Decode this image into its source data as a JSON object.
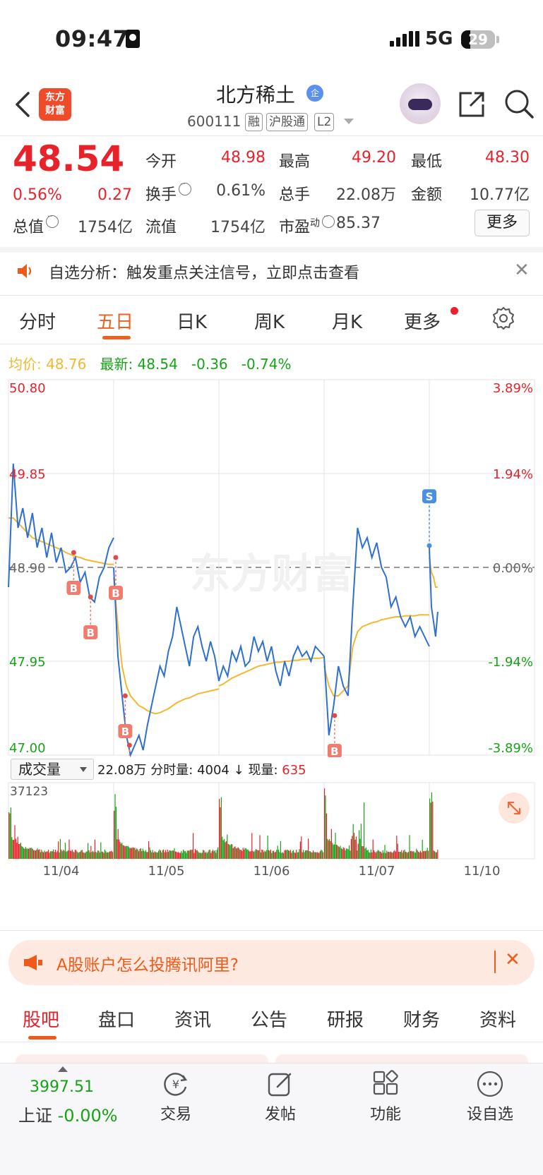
{
  "status_bar": {
    "time": "09:47",
    "network": "5G",
    "battery": "29"
  },
  "header": {
    "logo_line1": "东方",
    "logo_line2": "财富",
    "stock_name": "北方稀土",
    "company_badge": "企",
    "stock_code": "600111",
    "tags": [
      "融",
      "沪股通",
      "L2"
    ]
  },
  "quote": {
    "price": "48.54",
    "change_pct": "0.56%",
    "change": "0.27",
    "open_label": "今开",
    "open": "48.98",
    "high_label": "最高",
    "high": "49.20",
    "low_label": "最低",
    "low": "48.30",
    "turnover_label": "换手",
    "turnover": "0.61%",
    "volume_label": "总手",
    "volume": "22.08万",
    "amount_label": "金额",
    "amount": "10.77亿",
    "mktcap_label": "总值",
    "mktcap": "1754亿",
    "float_label": "流值",
    "float_cap": "1754亿",
    "pe_label": "市盈",
    "pe_sup": "动",
    "pe": "85.37",
    "more": "更多"
  },
  "notice": {
    "text": "自选分析：触发重点关注信号，立即点击查看"
  },
  "chart_tabs": [
    "分时",
    "五日",
    "日K",
    "周K",
    "月K",
    "更多"
  ],
  "avg_line": {
    "avg_label": "均价:",
    "avg_value": "48.76",
    "latest_label": "最新:",
    "latest_value": "48.54",
    "change": "-0.36",
    "change_pct": "-0.74%"
  },
  "chart_data": {
    "type": "line",
    "title": "",
    "y_left_ticks": [
      "50.80",
      "49.85",
      "48.90",
      "47.95",
      "47.00"
    ],
    "y_right_ticks": [
      "3.89%",
      "1.94%",
      "0.00%",
      "-1.94%",
      "-3.89%"
    ],
    "ylim": [
      47.0,
      50.8
    ],
    "reference": 48.9,
    "x_labels": [
      "11/04",
      "11/05",
      "11/06",
      "11/07",
      "11/10"
    ],
    "colors": {
      "price": "#2e6fd0",
      "avg": "#f2b830",
      "up": "#e8222a",
      "down": "#17a317",
      "marker_b": "#f07c6e",
      "marker_s": "#4a90e2"
    },
    "series": [
      {
        "day": "11/04",
        "price": [
          48.7,
          49.95,
          49.3,
          49.5,
          49.2,
          49.45,
          49.1,
          49.3,
          49.0,
          49.25,
          48.95,
          49.1,
          48.85,
          48.9,
          49.0,
          48.75,
          48.85,
          48.6,
          48.55,
          48.8,
          48.9,
          49.1,
          49.2
        ],
        "avg": [
          49.4,
          49.4,
          49.35,
          49.3,
          49.25,
          49.2,
          49.18,
          49.16,
          49.14,
          49.12,
          49.1,
          49.08,
          49.05,
          49.03,
          49.01,
          49.0,
          48.98,
          48.97,
          48.96,
          48.95,
          48.94,
          48.93,
          48.93
        ]
      },
      {
        "day": "11/05",
        "price": [
          48.9,
          48.0,
          47.6,
          47.2,
          47.0,
          47.1,
          47.2,
          47.05,
          47.3,
          47.5,
          47.7,
          47.9,
          47.8,
          48.05,
          48.2,
          48.5,
          48.3,
          48.1,
          47.9,
          48.2,
          48.3,
          48.1,
          47.95,
          48.15,
          48.0,
          47.75
        ],
        "avg": [
          48.8,
          48.3,
          47.9,
          47.7,
          47.6,
          47.55,
          47.5,
          47.48,
          47.45,
          47.43,
          47.42,
          47.43,
          47.45,
          47.47,
          47.5,
          47.53,
          47.55,
          47.57,
          47.58,
          47.6,
          47.62,
          47.63,
          47.64,
          47.65,
          47.66,
          47.67
        ]
      },
      {
        "day": "11/06",
        "price": [
          47.75,
          47.9,
          47.8,
          48.05,
          47.95,
          48.1,
          47.9,
          47.95,
          48.2,
          48.05,
          48.15,
          47.95,
          48.1,
          47.85,
          47.7,
          47.95,
          47.8,
          48.0,
          48.1,
          48.0,
          48.05,
          47.95,
          48.1,
          48.05,
          48.0
        ],
        "avg": [
          47.7,
          47.72,
          47.75,
          47.78,
          47.8,
          47.82,
          47.84,
          47.86,
          47.88,
          47.9,
          47.91,
          47.92,
          47.93,
          47.94,
          47.94,
          47.95,
          47.95,
          47.96,
          47.96,
          47.97,
          47.97,
          47.98,
          47.98,
          47.98,
          47.99
        ]
      },
      {
        "day": "11/07",
        "price": [
          48.0,
          47.2,
          47.5,
          47.9,
          47.7,
          47.6,
          48.5,
          49.3,
          49.1,
          49.2,
          49.0,
          49.15,
          48.9,
          48.8,
          48.5,
          48.6,
          48.4,
          48.3,
          48.4,
          48.2,
          48.3,
          48.2,
          48.1
        ],
        "avg": [
          47.9,
          47.7,
          47.6,
          47.6,
          47.65,
          47.7,
          48.1,
          48.25,
          48.3,
          48.32,
          48.34,
          48.35,
          48.37,
          48.38,
          48.39,
          48.4,
          48.4,
          48.41,
          48.41,
          48.41,
          48.42,
          48.42,
          48.42
        ]
      },
      {
        "day": "11/10",
        "price": [
          49.1,
          48.5,
          48.35,
          48.2,
          48.45
        ],
        "avg": [
          49.0,
          48.85,
          48.8,
          48.7,
          48.7
        ]
      }
    ],
    "markers": [
      {
        "label": "B",
        "day": 0,
        "pos": 0.62,
        "price": 49.05
      },
      {
        "label": "B",
        "day": 0,
        "pos": 0.78,
        "price": 48.6
      },
      {
        "label": "B",
        "day": 1,
        "pos": 0.02,
        "price": 49.0
      },
      {
        "label": "B",
        "day": 1,
        "pos": 0.11,
        "price": 47.6
      },
      {
        "label": "B",
        "day": 1,
        "pos": 0.15,
        "price": 47.1
      },
      {
        "label": "B",
        "day": 3,
        "pos": 0.1,
        "price": 47.4
      },
      {
        "label": "S",
        "day": 4,
        "pos": 0.0,
        "price": 49.12
      }
    ]
  },
  "volume_bar": {
    "selector": "成交量",
    "total": "22.08万",
    "tick_label": "分时量:",
    "tick_value": "4004",
    "arrow": "↓",
    "current_label": "现量:",
    "current_value": "635",
    "max_label": "37123"
  },
  "ad": {
    "text": "A股账户怎么投腾讯阿里?"
  },
  "bottom_tabs": [
    "股吧",
    "盘口",
    "资讯",
    "公告",
    "研报",
    "财务",
    "资料"
  ],
  "tabbar": {
    "index_value": "3997.51",
    "index_name": "上证",
    "index_change": "-0.00%",
    "items": [
      "交易",
      "发帖",
      "功能",
      "设自选"
    ]
  },
  "watermark": "东方财富"
}
